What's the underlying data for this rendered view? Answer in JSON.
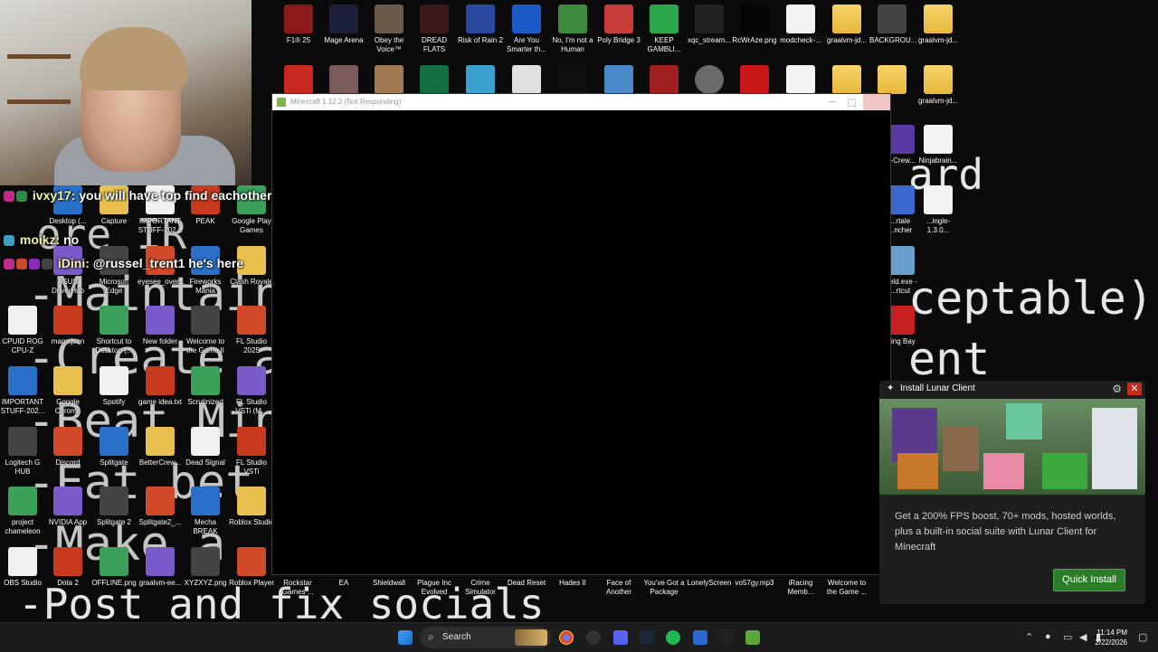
{
  "background_text": {
    "lines": [
      "ard",
      "ore IR",
      "-Maintain",
      "-Create a",
      "-Beat Min",
      "-Eat bet",
      "-Make a",
      "-Post and fix socials",
      "ceptable)",
      "ent"
    ]
  },
  "webcam": {
    "label": "webcam"
  },
  "chat": [
    {
      "user": "ivxy17:",
      "message": "you will have top find eachother @xQc"
    },
    {
      "user": "moikz:",
      "message": "no"
    },
    {
      "user": "iDini:",
      "message": "@russel_trent1 he's here"
    }
  ],
  "desktop_icons_top": [
    "F1® 25",
    "Mage Arena",
    "Obey the Voice™",
    "DREAD FLATS",
    "Risk of Rain 2",
    "Are You Smarter th...",
    "No, I'm not a Human",
    "Poly Bridge 3",
    "KEEP GAMBLI...",
    "xqc_stream...",
    "RcWrAze.png",
    "modcheck-...",
    "graalvm-jd...",
    "BACKGROU...",
    "graalvm-jd..."
  ],
  "desktop_icons_left": [
    "Desktop (...",
    "Capture",
    "IMPORTANT STUFF-202...",
    "PEAK",
    "Google Play Games",
    "ASUS DriverHub",
    "Microsoft Edge",
    "eyesee_over...",
    "Fireworks Mania",
    "Clash Royale",
    "CPUID ROG CPU-Z",
    "maps.json",
    "Shortcut to Desktop (...",
    "New folder",
    "Welcome to the Game II",
    "FL Studio 2025",
    "IMPORTANT STUFF-202...",
    "Google Chrome",
    "Spotify",
    "game idea.txt",
    "Scrutinized",
    "FL Studio VSTi (M...",
    "Logitech G HUB",
    "Discord",
    "Splitgate",
    "BetterCrew...",
    "Dead Signal",
    "FL Studio VSTi",
    "project chameleon",
    "NVIDIA App",
    "Splitgate 2",
    "Splitgate2_...",
    "Mecha BREAK",
    "Roblox Studio",
    "OBS Studio",
    "Dota 2",
    "OFFLINE.png",
    "graalvm-ee...",
    "XYZXYZ.png",
    "Roblox Player"
  ],
  "desktop_icons_bottom": [
    "Rockstar Games ...",
    "EA",
    "Shieldwall",
    "Plague Inc Evolved",
    "Crime Simulator",
    "Dead Reset",
    "Hades II",
    "Face of Another",
    "You've Got a Package",
    "LonelyScreen",
    "vo57gy.mp3",
    "iRacing Memb...",
    "Welcome to the Game ..."
  ],
  "desktop_icons_right": [
    "...-Crew...",
    "Ninjabrain...",
    "...rtale ...ncher",
    "...ingle-1.3.0...",
    "...eld.exe - ...rtcut",
    "...ing Bay"
  ],
  "minecraft_window": {
    "title": "Minecraft 1.12.2 (Not Responding)"
  },
  "lunar_popup": {
    "title": "Install Lunar Client",
    "description": "Get a 200% FPS boost, 70+ mods, hosted worlds, plus a built-in social suite with Lunar Client for Minecraft",
    "button": "Quick Install",
    "close": "✕",
    "settings": "⚙"
  },
  "taskbar": {
    "search_placeholder": "Search",
    "time": "11:14 PM",
    "date": "2/22/2026"
  },
  "colors": {
    "accent_green": "#2c7d2a",
    "close_red": "#c42b1c",
    "taskbar": "#1c1c1c"
  }
}
